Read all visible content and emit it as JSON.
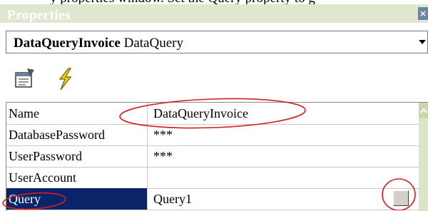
{
  "page": {
    "cut_text": "y properties window. Set the Query property to g"
  },
  "window": {
    "title": "Properties",
    "close_glyph": "×",
    "accent_color": "#dfe7cf",
    "selection_color": "#0a246a"
  },
  "object_selector": {
    "object_name": "DataQueryInvoice",
    "object_type": "DataQuery"
  },
  "toolbar": {
    "buttons": [
      {
        "icon": "property-pages-icon"
      },
      {
        "icon": "events-lightning-icon"
      }
    ]
  },
  "properties": [
    {
      "name": "Name",
      "value": "DataQueryInvoice",
      "selected": false
    },
    {
      "name": "DatabasePassword",
      "value": "***",
      "selected": false
    },
    {
      "name": "UserPassword",
      "value": "***",
      "selected": false
    },
    {
      "name": "UserAccount",
      "value": "",
      "selected": false
    },
    {
      "name": "Query",
      "value": "Query1",
      "selected": true,
      "has_ellipsis_button": true
    }
  ]
}
